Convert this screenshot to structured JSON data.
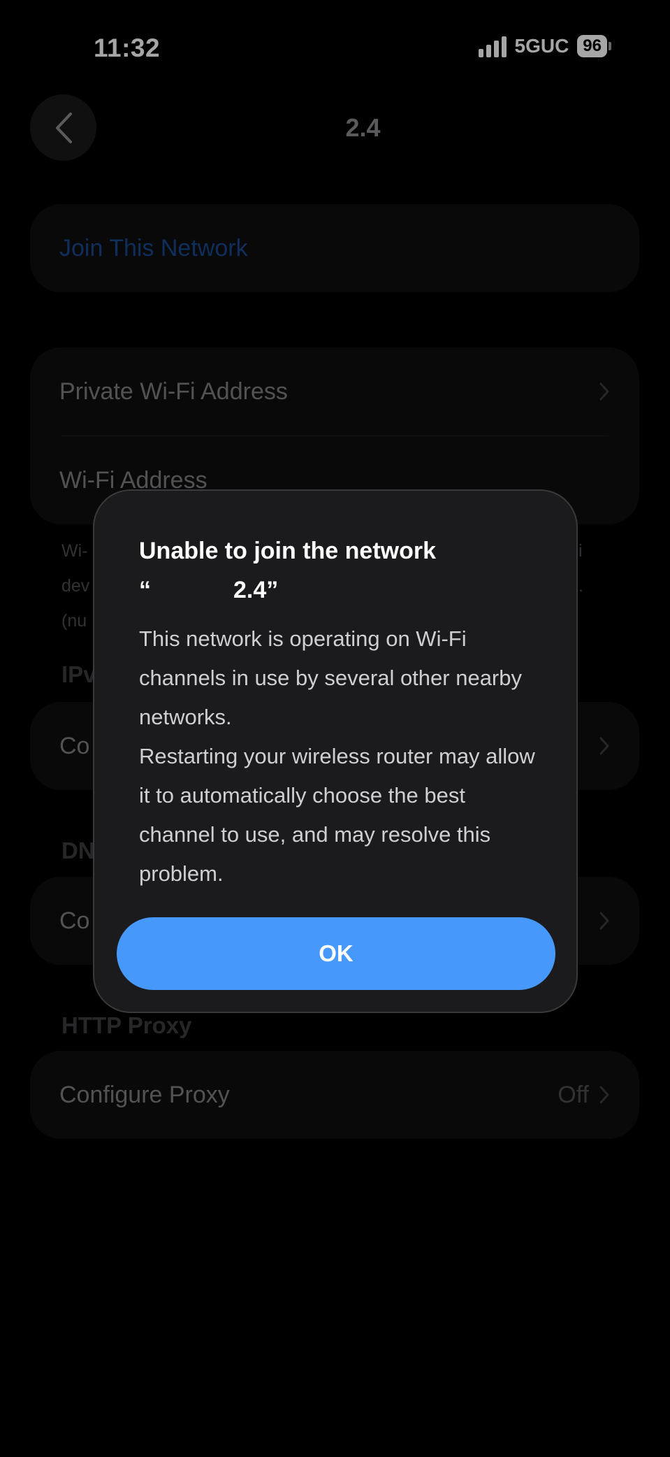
{
  "status_bar": {
    "time": "11:32",
    "network": "5GUC",
    "battery": "96"
  },
  "nav": {
    "title": "2.4"
  },
  "join_card": {
    "label": "Join This Network"
  },
  "address_card": {
    "private_label": "Private Wi-Fi Address",
    "wifi_label": "Wi-Fi Address"
  },
  "note_fragments": [
    "Wi-",
    "i",
    "dev",
    ".",
    "(nu"
  ],
  "ipv4": {
    "header": "IPv",
    "row_label": "Co"
  },
  "dns": {
    "header": "DN",
    "row_label": "Co"
  },
  "http_proxy": {
    "header": "HTTP Proxy",
    "row_label": "Configure Proxy",
    "value": "Off"
  },
  "alert": {
    "title_line1": "Unable to join the network",
    "title_quote_open": "“",
    "title_line2": "2.4”",
    "message_line1": "This network is operating on Wi-Fi channels in use by several other nearby networks.",
    "message_line2": "Restarting your wireless router may allow it to automatically choose the best channel to use, and may resolve this problem.",
    "ok_label": "OK"
  },
  "colors": {
    "accent": "#4699fb",
    "link": "#2f82ff",
    "card": "#1c1c1e"
  }
}
